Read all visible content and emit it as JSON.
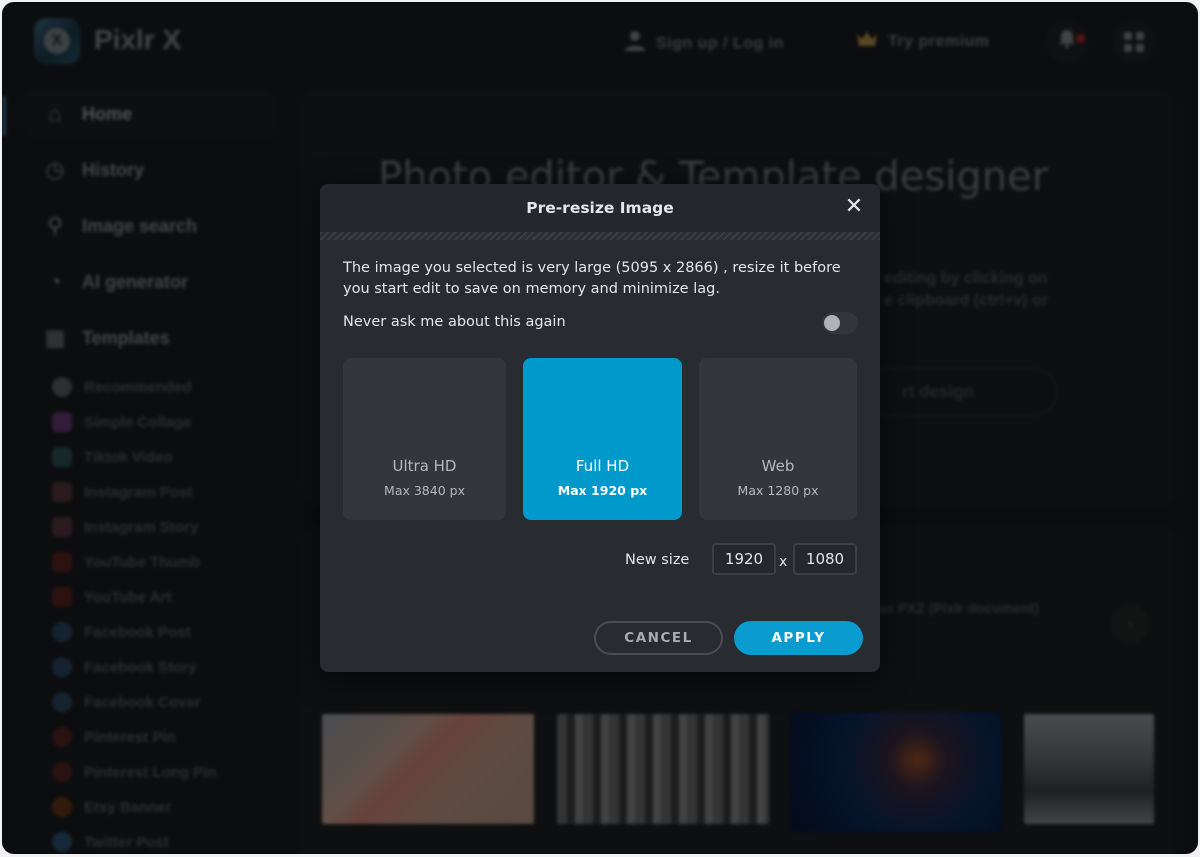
{
  "app": {
    "title": "Pixlr X",
    "logo_glyph": "X"
  },
  "topbar": {
    "signup_label": "Sign up / Log in",
    "premium_label": "Try premium",
    "icons": {
      "user": "user-icon",
      "crown": "crown-icon",
      "bell": "bell-icon",
      "apps": "apps-grid-icon"
    },
    "has_notification": true
  },
  "sidebar": {
    "nav": [
      {
        "label": "Home",
        "icon": "home-icon",
        "glyph": "⌂",
        "active": true
      },
      {
        "label": "History",
        "icon": "clock-icon",
        "glyph": "◷",
        "active": false
      },
      {
        "label": "Image search",
        "icon": "search-icon",
        "glyph": "⚲",
        "active": false
      },
      {
        "label": "AI generator",
        "icon": "ai-icon",
        "glyph": "◔",
        "active": false
      },
      {
        "label": "Templates",
        "icon": "templates-icon",
        "glyph": "▦",
        "active": false
      }
    ],
    "templates": [
      {
        "label": "Recommended",
        "icon": "eye-icon",
        "color": "#5f6266",
        "shape": "round"
      },
      {
        "label": "Simple Collage",
        "icon": "collage-icon",
        "color": "#6c3f78",
        "shape": "square"
      },
      {
        "label": "Tiktok Video",
        "icon": "tiktok-icon",
        "color": "#2f5458",
        "shape": "square"
      },
      {
        "label": "Instagram Post",
        "icon": "instagram-icon",
        "color": "#5a3a3c",
        "shape": "square"
      },
      {
        "label": "Instagram Story",
        "icon": "instagram-icon",
        "color": "#5a3a40",
        "shape": "square"
      },
      {
        "label": "YouTube Thumb",
        "icon": "youtube-icon",
        "color": "#5e2424",
        "shape": "square"
      },
      {
        "label": "YouTube Art",
        "icon": "youtube-icon",
        "color": "#5e2424",
        "shape": "square"
      },
      {
        "label": "Facebook Post",
        "icon": "facebook-icon",
        "color": "#2c4a68",
        "shape": "round"
      },
      {
        "label": "Facebook Story",
        "icon": "facebook-icon",
        "color": "#2c4a68",
        "shape": "round"
      },
      {
        "label": "Facebook Cover",
        "icon": "facebook-icon",
        "color": "#2c4a68",
        "shape": "round"
      },
      {
        "label": "Pinterest Pin",
        "icon": "pinterest-icon",
        "color": "#5a2626",
        "shape": "round"
      },
      {
        "label": "Pinterest Long Pin",
        "icon": "pinterest-icon",
        "color": "#5a2626",
        "shape": "round"
      },
      {
        "label": "Etsy Banner",
        "icon": "etsy-icon",
        "color": "#6a3818",
        "shape": "round"
      },
      {
        "label": "Twitter Post",
        "icon": "twitter-icon",
        "color": "#2a5878",
        "shape": "round"
      }
    ]
  },
  "main": {
    "hero_title": "Photo editor & Template designer",
    "hero_text": "editing by clicking on\ne clipboard (ctrl+v) or",
    "hero_button": "rt design",
    "recent_text": "as PXZ (Pixlr document)",
    "next_glyph": "›"
  },
  "modal": {
    "title": "Pre-resize Image",
    "close_glyph": "✕",
    "message": "The image you selected is very large (5095 x 2866) , resize it before you start edit to save on memory and minimize lag.",
    "never_ask_label": "Never ask me about this again",
    "never_ask_enabled": false,
    "options": [
      {
        "title": "Ultra HD",
        "subtitle": "Max 3840 px",
        "selected": false
      },
      {
        "title": "Full HD",
        "subtitle": "Max 1920 px",
        "selected": true
      },
      {
        "title": "Web",
        "subtitle": "Max 1280 px",
        "selected": false
      }
    ],
    "new_size_label": "New size",
    "width_value": "1920",
    "height_value": "1080",
    "separator": "x",
    "cancel_label": "CANCEL",
    "apply_label": "APPLY",
    "accent_color": "#0099cc"
  }
}
